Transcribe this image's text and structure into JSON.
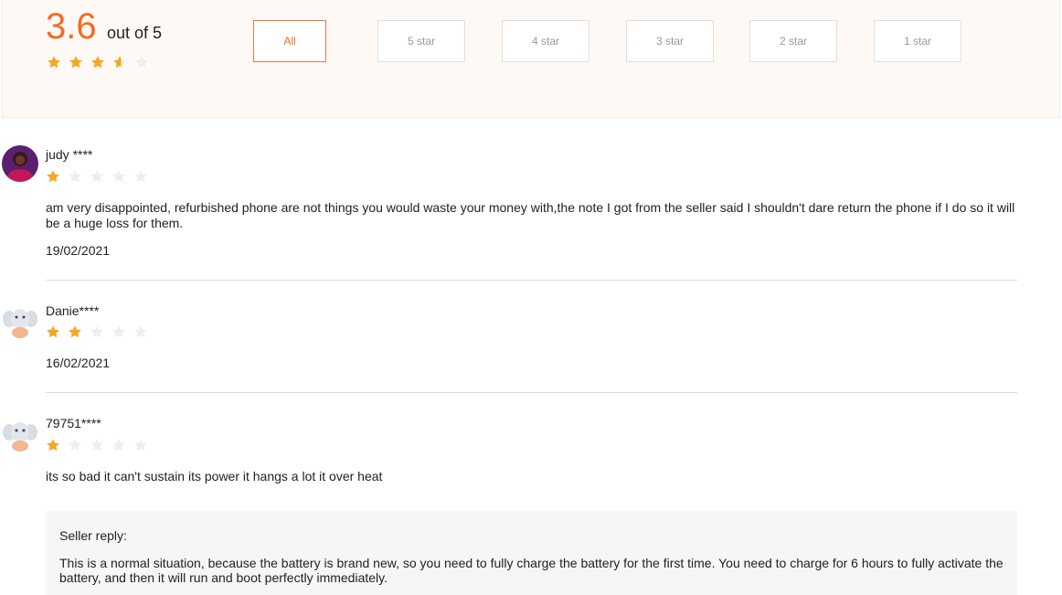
{
  "summary": {
    "score": "3.6",
    "score_suffix": "out of 5",
    "star_fill": [
      1,
      1,
      1,
      0.6,
      0
    ],
    "filters": [
      "All",
      "5 star",
      "4 star",
      "3 star",
      "2 star",
      "1 star"
    ],
    "active_filter": "All"
  },
  "colors": {
    "accent": "#f56a23",
    "star_filled": "#f5a623",
    "star_empty": "#eceef2"
  },
  "reviews": [
    {
      "username": "judy ****",
      "avatar": "user-photo-avatar",
      "rating": 1,
      "text": "am very disappointed, refurbished phone are not things you would waste your money with,the note I got from the seller said I shouldn't dare return the phone if I do so it will be a huge loss for them.",
      "date": "19/02/2021"
    },
    {
      "username": "Danie****",
      "avatar": "elephant-avatar",
      "rating": 2,
      "text": "",
      "date": "16/02/2021"
    },
    {
      "username": "79751****",
      "avatar": "elephant-avatar",
      "rating": 1,
      "text": "its so bad it can't sustain its power it hangs a lot it over heat",
      "date": ""
    }
  ],
  "seller_reply": {
    "label": "Seller reply:",
    "text": "This is a normal situation, because the battery is brand new, so you need to fully charge the battery for the first time. You need to charge for 6 hours to fully activate the battery, and then it will run and boot perfectly immediately."
  }
}
